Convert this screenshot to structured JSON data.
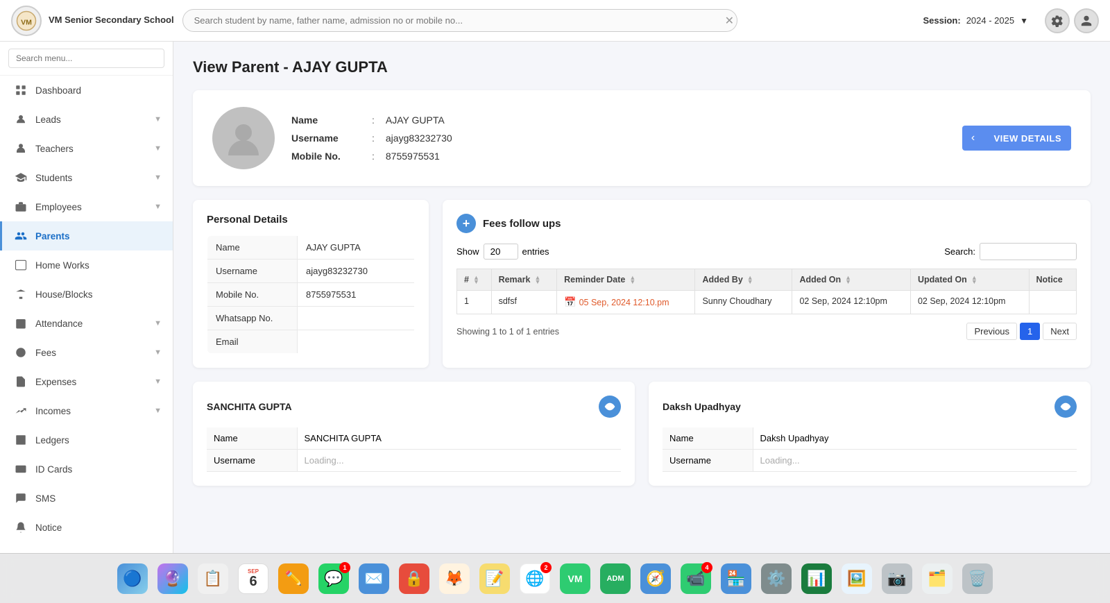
{
  "topbar": {
    "logo_text": "VM Senior Secondary\nSchool",
    "search_placeholder": "Search student by name, father name, admission no or mobile no...",
    "session_label": "Session:",
    "session_value": "2024 - 2025"
  },
  "sidebar": {
    "search_placeholder": "Search menu...",
    "items": [
      {
        "id": "dashboard",
        "label": "Dashboard",
        "icon": "grid"
      },
      {
        "id": "leads",
        "label": "Leads",
        "icon": "target",
        "has_chevron": true
      },
      {
        "id": "teachers",
        "label": "Teachers",
        "icon": "person-tie",
        "has_chevron": true
      },
      {
        "id": "students",
        "label": "Students",
        "icon": "person",
        "has_chevron": true
      },
      {
        "id": "employees",
        "label": "Employees",
        "icon": "briefcase",
        "has_chevron": true
      },
      {
        "id": "parents",
        "label": "Parents",
        "icon": "people",
        "active": true
      },
      {
        "id": "homeworks",
        "label": "Home Works",
        "icon": "book"
      },
      {
        "id": "house-blocks",
        "label": "House/Blocks",
        "icon": "building"
      },
      {
        "id": "attendance",
        "label": "Attendance",
        "icon": "calendar-check",
        "has_chevron": true
      },
      {
        "id": "fees",
        "label": "Fees",
        "icon": "money",
        "has_chevron": true
      },
      {
        "id": "expenses",
        "label": "Expenses",
        "icon": "receipt",
        "has_chevron": true
      },
      {
        "id": "incomes",
        "label": "Incomes",
        "icon": "chart-up",
        "has_chevron": true
      },
      {
        "id": "ledgers",
        "label": "Ledgers",
        "icon": "ledger"
      },
      {
        "id": "id-cards",
        "label": "ID Cards",
        "icon": "id-card"
      },
      {
        "id": "sms",
        "label": "SMS",
        "icon": "message"
      },
      {
        "id": "notice",
        "label": "Notice",
        "icon": "bell"
      }
    ]
  },
  "page": {
    "title": "View Parent - AJAY GUPTA",
    "profile": {
      "name_label": "Name",
      "name_value": "AJAY GUPTA",
      "username_label": "Username",
      "username_value": "ajayg83232730",
      "mobile_label": "Mobile No.",
      "mobile_value": "8755975531",
      "view_details_btn": "VIEW DETAILS"
    },
    "personal_details": {
      "title": "Personal Details",
      "rows": [
        {
          "label": "Name",
          "value": "AJAY GUPTA"
        },
        {
          "label": "Username",
          "value": "ajayg83232730"
        },
        {
          "label": "Mobile No.",
          "value": "8755975531"
        },
        {
          "label": "Whatsapp No.",
          "value": ""
        },
        {
          "label": "Email",
          "value": ""
        }
      ]
    },
    "fees_followups": {
      "title": "Fees follow ups",
      "show_label": "Show",
      "show_value": "20",
      "entries_label": "entries",
      "search_label": "Search:",
      "columns": [
        "#",
        "Remark",
        "Reminder Date",
        "Added By",
        "Added On",
        "Updated On",
        "Notice"
      ],
      "rows": [
        {
          "num": "1",
          "remark": "sdfsf",
          "reminder_date": "05 Sep, 2024 12:10.pm",
          "added_by": "Sunny Choudhary",
          "added_on": "02 Sep, 2024 12:10pm",
          "updated_on": "02 Sep, 2024 12:10pm",
          "notice": ""
        }
      ],
      "showing_text": "Showing 1 to 1 of 1 entries",
      "previous_btn": "Previous",
      "page_num": "1",
      "next_btn": "Next"
    },
    "child1": {
      "name": "SANCHITA GUPTA",
      "rows": [
        {
          "label": "Name",
          "value": "SANCHITA GUPTA"
        },
        {
          "label": "Username",
          "value": "..."
        }
      ]
    },
    "child2": {
      "name": "Daksh Upadhyay",
      "rows": [
        {
          "label": "Name",
          "value": "Daksh Upadhyay"
        },
        {
          "label": "Username",
          "value": "..."
        }
      ]
    }
  },
  "dock": {
    "items": [
      {
        "id": "finder",
        "label": "Finder",
        "color": "#4a90d9",
        "icon": "🔵"
      },
      {
        "id": "siri",
        "label": "Siri",
        "color": "#9b59b6",
        "icon": "🔮"
      },
      {
        "id": "contacts",
        "label": "Contacts",
        "color": "#f0f0f0",
        "icon": "📋"
      },
      {
        "id": "calendar",
        "label": "Calendar",
        "color": "#fff",
        "icon": "📅",
        "date": "6"
      },
      {
        "id": "sublime",
        "label": "Sublime",
        "color": "#f39c12",
        "icon": "✏️"
      },
      {
        "id": "whatsapp",
        "label": "WhatsApp",
        "color": "#25d366",
        "icon": "💬",
        "badge": "1"
      },
      {
        "id": "mail",
        "label": "Mail",
        "color": "#4a90d9",
        "icon": "✉️"
      },
      {
        "id": "openvpn",
        "label": "OpenVPN",
        "color": "#e74c3c",
        "icon": "🔒"
      },
      {
        "id": "firefox",
        "label": "Firefox",
        "color": "#e8772e",
        "icon": "🦊"
      },
      {
        "id": "notes",
        "label": "Notes",
        "color": "#f7dc6f",
        "icon": "📝"
      },
      {
        "id": "chrome",
        "label": "Chrome",
        "color": "#fff",
        "icon": "🌐",
        "badge": "2"
      },
      {
        "id": "vidmarg",
        "label": "Vidmarg",
        "color": "#2ecc71",
        "icon": "V"
      },
      {
        "id": "vidmarg-admin",
        "label": "Vidmarg Admin",
        "color": "#27ae60",
        "icon": "VA"
      },
      {
        "id": "safari",
        "label": "Safari",
        "color": "#4a90d9",
        "icon": "🧭"
      },
      {
        "id": "facetime",
        "label": "FaceTime",
        "color": "#2ecc71",
        "icon": "📷",
        "badge": "4"
      },
      {
        "id": "appstore",
        "label": "App Store",
        "color": "#4a90d9",
        "icon": "🏪"
      },
      {
        "id": "settings",
        "label": "System Settings",
        "color": "#7f8c8d",
        "icon": "⚙️"
      },
      {
        "id": "excel",
        "label": "Excel",
        "color": "#1a7c3e",
        "icon": "📊"
      },
      {
        "id": "preview",
        "label": "Preview",
        "color": "#4a90d9",
        "icon": "👁️"
      },
      {
        "id": "capture",
        "label": "Capture",
        "color": "#7f8c8d",
        "icon": "📷"
      },
      {
        "id": "finder2",
        "label": "Finder Window",
        "color": "#c0c0c0",
        "icon": "🗂️"
      },
      {
        "id": "trash",
        "label": "Trash",
        "color": "#7f8c8d",
        "icon": "🗑️"
      }
    ]
  }
}
